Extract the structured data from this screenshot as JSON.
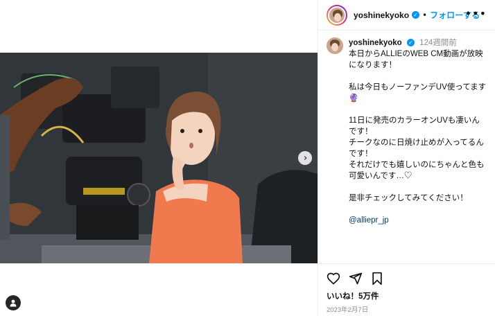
{
  "post": {
    "username": "yoshinekyoko",
    "verified": true,
    "follow_label": "フォローする",
    "separator": "•",
    "more_label": "•••",
    "time_ago": "124週間前",
    "caption_lines": [
      "本日からALLIEのWEB CM動画が放映になります！",
      "",
      "私は今日もノーファンデUV使ってます🔮",
      "",
      "11日に発売のカラーオンUVも凄いんです！",
      "チークなのに日焼け止めが入ってるんです！",
      "それだけでも嬉しいのにちゃんと色も可愛いんです…♡",
      "",
      "是非チェックしてみてください！",
      ""
    ],
    "mention": "@alliepr_jp",
    "likes": "いいね！5万件",
    "date": "2023年2月7日"
  },
  "icons": {
    "next": "chevron-right-icon",
    "tag": "user-tag-icon",
    "like": "heart-icon",
    "share": "send-icon",
    "save": "bookmark-icon"
  },
  "colors": {
    "follow": "#0095f6",
    "verified": "#0095f6",
    "mention": "#00376b",
    "muted": "#8e8e8e"
  }
}
